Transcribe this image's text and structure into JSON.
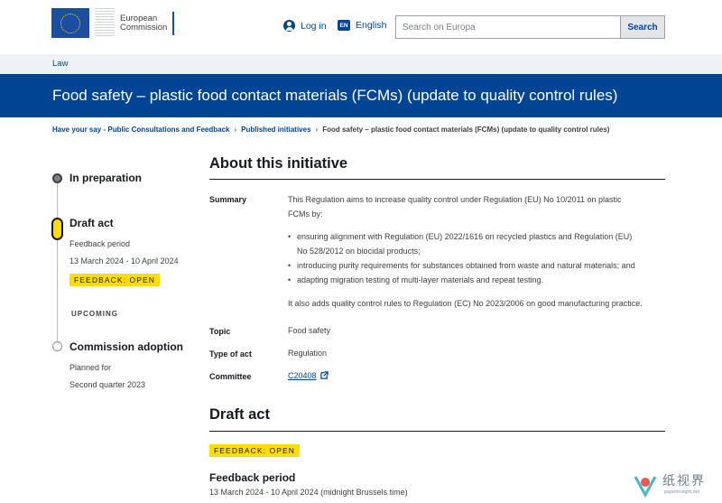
{
  "header": {
    "logo_line1": "European",
    "logo_line2": "Commission",
    "login_label": "Log in",
    "language_code": "EN",
    "language_label": "English",
    "search_placeholder": "Search on Europa",
    "search_button": "Search"
  },
  "section": {
    "label": "Law"
  },
  "page_title": "Food safety – plastic food contact materials (FCMs) (update to quality control rules)",
  "breadcrumb": [
    "Have your say - Public Consultations and Feedback",
    "Published initiatives",
    "Food safety – plastic food contact materials (FCMs) (update to quality control rules)"
  ],
  "timeline": {
    "stage1": {
      "title": "In preparation"
    },
    "stage2": {
      "title": "Draft act",
      "line1": "Feedback period",
      "line2": "13 March 2024 - 10 April 2024",
      "badge": "FEEDBACK: OPEN"
    },
    "upcoming_label": "UPCOMING",
    "stage3": {
      "title": "Commission adoption",
      "line1": "Planned for",
      "line2": "Second quarter 2023"
    }
  },
  "about": {
    "heading": "About this initiative",
    "summary_label": "Summary",
    "summary_intro_1": "This Regulation aims to increase quality control under Regulation (EU) No 10/2011 on plastic",
    "summary_intro_2": "FCMs by:",
    "bullets": [
      "ensuring alignment with Regulation (EU) 2022/1616 on recycled plastics and Regulation (EU)",
      "No 528/2012 on biocidal products;",
      "introducing purity requirements for substances obtained from waste and natural materials; and",
      "adapting migration testing of multi-layer materials and repeat testing."
    ],
    "summary_outro": "It also adds quality control rules to Regulation (EC) No 2023/2006 on good manufacturing practice.",
    "topic_label": "Topic",
    "topic_value": "Food safety",
    "type_label": "Type of act",
    "type_value": "Regulation",
    "committee_label": "Committee",
    "committee_value": "C20408"
  },
  "draft_act": {
    "heading": "Draft act",
    "badge": "FEEDBACK: OPEN",
    "feedback_title": "Feedback period",
    "feedback_dates": "13 March 2024 - 10 April 2024  (midnight Brussels time)"
  },
  "watermark": {
    "text": "纸视界",
    "sub": "paperinsight.net"
  },
  "colors": {
    "primary": "#004494",
    "accent": "#fd0",
    "section_bg": "#eef1f6"
  }
}
